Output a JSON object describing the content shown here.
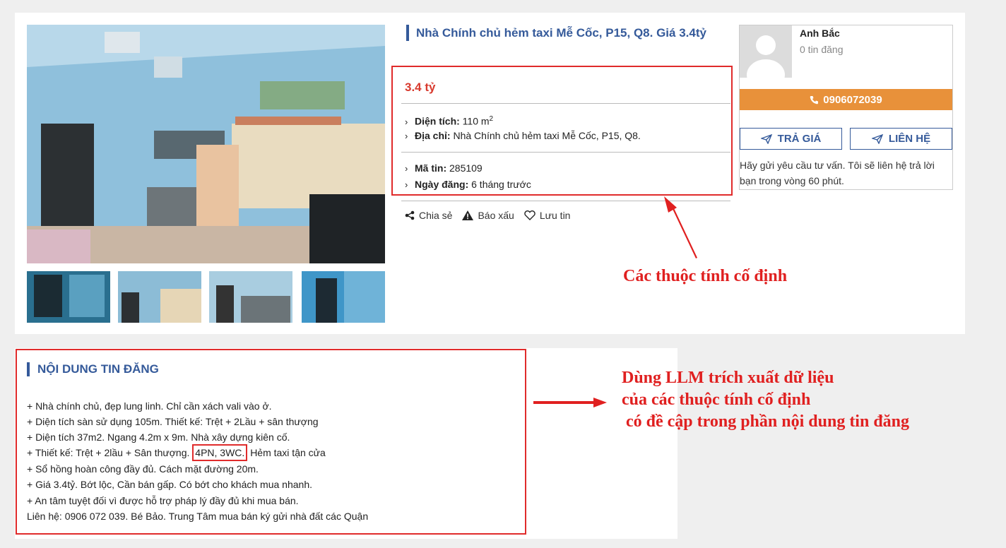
{
  "listing": {
    "title": "Nhà Chính chủ hẻm taxi Mễ Cốc, P15, Q8. Giá 3.4tỷ",
    "price": "3.4 tỷ",
    "area_label": "Diện tích:",
    "area_value": "110 m",
    "area_unit_sup": "2",
    "address_label": "Địa chỉ:",
    "address_value": "Nhà Chính chủ hẻm taxi Mễ Cốc, P15, Q8.",
    "code_label": "Mã tin:",
    "code_value": "285109",
    "date_label": "Ngày đăng:",
    "date_value": "6 tháng trước",
    "actions": {
      "share": "Chia sẻ",
      "report": "Báo xấu",
      "save": "Lưu tin"
    },
    "photo_count": 5
  },
  "seller": {
    "name": "Anh Bắc",
    "posts": "0 tin đăng",
    "phone": "0906072039",
    "bid_label": "TRẢ GIÁ",
    "contact_label": "LIÊN HỆ",
    "note": "Hãy gửi yêu cầu tư vấn. Tôi sẽ liên hệ trả lời bạn trong vòng 60 phút."
  },
  "content": {
    "section_title": "NỘI DUNG TIN ĐĂNG",
    "lines": [
      "+ Nhà chính chủ, đẹp lung linh. Chỉ cần xách vali vào ở.",
      "+ Diện tích sàn sử dụng 105m. Thiết kế: Trệt + 2Lầu + sân thượng",
      "+ Diện tích 37m2. Ngang 4.2m x 9m. Nhà xây dựng kiên cố.",
      "+ Thiết kế: Trệt + 2lầu + Sân thượng.",
      "4PN, 3WC.",
      "Hẻm taxi tận cửa",
      "+ Sổ hồng hoàn công đầy đủ. Cách mặt đường 20m.",
      "+ Giá 3.4tỷ. Bớt lộc, Cần bán gấp. Có bớt cho khách mua nhanh.",
      "+ An tâm tuyệt đối vì được hỗ trợ pháp lý đầy đủ khi mua bán.",
      "Liên hệ: 0906 072 039. Bé Bảo. Trung Tâm mua bán ký gửi nhà đất các Quận"
    ]
  },
  "annotations": {
    "fixed_attributes": "Các thuộc tính cố định",
    "llm_line1": "Dùng LLM trích xuất dữ liệu",
    "llm_line2": "của các thuộc tính cố định",
    "llm_line3": " có đề cập trong phần nội dung tin đăng"
  },
  "colors": {
    "accent": "#355a9a",
    "price": "#d83a2e",
    "phone_button": "#e8913a",
    "annotation": "#e02020"
  }
}
